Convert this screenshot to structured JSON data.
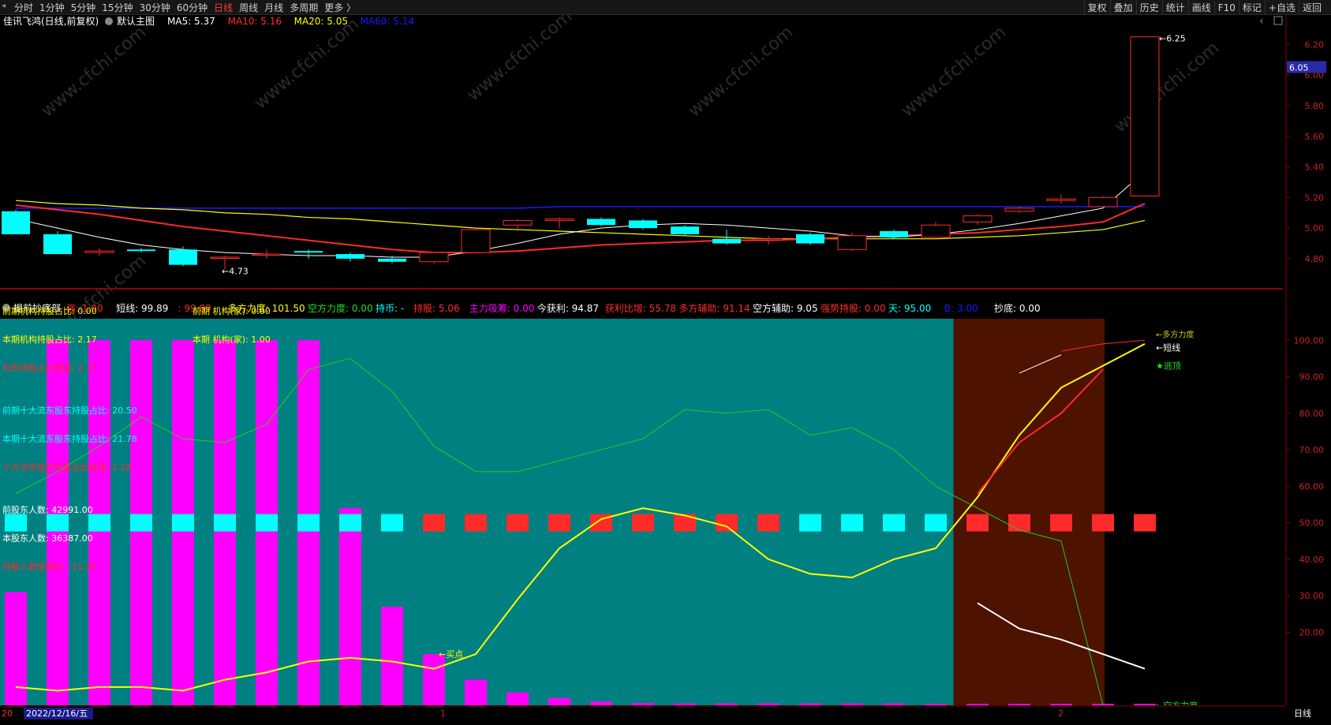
{
  "toolbar": {
    "periods": [
      "分时",
      "1分钟",
      "5分钟",
      "15分钟",
      "30分钟",
      "60分钟",
      "日线",
      "周线",
      "月线",
      "多周期",
      "更多 〉"
    ],
    "active_period": "日线",
    "tools": [
      "复权",
      "叠加",
      "历史",
      "统计",
      "画线",
      "F10",
      "标记",
      "+自选",
      "返回"
    ]
  },
  "colors": {
    "bg": "#000000",
    "red": "#ff2a2a",
    "cyan": "#00ffff",
    "yellow": "#ffff00",
    "magenta": "#ff00ff",
    "teal": "#008080",
    "brown": "#4d1200",
    "blue": "#1a1aff",
    "white": "#ffffff"
  },
  "main": {
    "stock": "佳讯飞鸿(日线,前复权)",
    "template": "默认主图",
    "ma": [
      {
        "label": "MA5: 5.37",
        "color": "#ffffff"
      },
      {
        "label": "MA10: 5.16",
        "color": "#ff2a2a"
      },
      {
        "label": "MA20: 5.05",
        "color": "#ffff00"
      },
      {
        "label": "MA60: 5.14",
        "color": "#1a1aff"
      }
    ],
    "high_label": "6.25",
    "low_label": "4.73",
    "current_price": "6.05"
  },
  "indicator": {
    "name": "提前抄底部",
    "stats": [
      {
        "t": "强: 1.00",
        "c": "#ff2a2a"
      },
      {
        "t": "短线: 99.89",
        "c": "#ffffff"
      },
      {
        "t": ": 99.89",
        "c": "#ff2a2a"
      },
      {
        "t": "多方力度: 101.50",
        "c": "#ffff00"
      },
      {
        "t": "空方力度: 0.00",
        "c": "#22dd22"
      },
      {
        "t": "持币: -",
        "c": "#00ffff"
      },
      {
        "t": "持股: 5.06",
        "c": "#ff2a2a"
      },
      {
        "t": "主力吸筹: 0.00",
        "c": "#ff00ff"
      },
      {
        "t": "今获利: 94.87",
        "c": "#ffffff"
      },
      {
        "t": "获利比增: 55.78",
        "c": "#ff2a2a"
      },
      {
        "t": "多方辅助: 91.14",
        "c": "#ff2a2a"
      },
      {
        "t": "空方辅助: 9.05",
        "c": "#ffffff"
      },
      {
        "t": "强势持股: 0.00",
        "c": "#ff2a2a"
      },
      {
        "t": "天: 95.00",
        "c": "#00ffff"
      },
      {
        "t": "B: 3.00",
        "c": "#1a1aff"
      },
      {
        "t": "抄底: 0.00",
        "c": "#ffffff"
      }
    ],
    "notes": [
      {
        "t": "前期机构持股占比: 0.00",
        "c": "#ffff00"
      },
      {
        "t": "本期机构持股占比: 2.17",
        "c": "#ffff00"
      },
      {
        "t": "机构持股占比增减: 2.17",
        "c": "#ff2a2a"
      },
      {
        "t": "前期十大流东股东持股占比: 20.50",
        "c": "#00ffff"
      },
      {
        "t": "本期十大流东股东持股占比: 21.78",
        "c": "#00ffff"
      },
      {
        "t": "十大流东股东持股占比增减: 1.28",
        "c": "#ff2a2a"
      },
      {
        "t": "前股东人数: 42991.00",
        "c": "#ffffff"
      },
      {
        "t": "本股东人数: 36387.00",
        "c": "#ffffff"
      },
      {
        "t": "持股人数增减比: -15.36",
        "c": "#ff2a2a"
      }
    ],
    "notes2": [
      {
        "t": "前期 机构(家): 0.00",
        "c": "#ffff00"
      },
      {
        "t": "本期 机构(家): 1.00",
        "c": "#ffff00"
      }
    ],
    "label_buy": "买点",
    "label_escape": "★逃顶",
    "label_short": "←短线",
    "label_bull": "←多方力度",
    "label_bear": "←空方力度"
  },
  "x_axis": {
    "date": "2022/12/16/五",
    "m1": "1",
    "m2": "2",
    "lead": "20"
  },
  "right_label": "日线",
  "chart_data": [
    {
      "type": "candlestick",
      "ylim": [
        4.65,
        6.3
      ],
      "yticks": [
        4.8,
        5.0,
        5.2,
        5.4,
        5.6,
        5.8,
        6.0,
        6.2
      ],
      "candles": [
        {
          "o": 5.11,
          "h": 5.12,
          "l": 4.96,
          "c": 4.96
        },
        {
          "o": 4.96,
          "h": 4.98,
          "l": 4.83,
          "c": 4.83
        },
        {
          "o": 4.84,
          "h": 4.87,
          "l": 4.82,
          "c": 4.85
        },
        {
          "o": 4.86,
          "h": 4.87,
          "l": 4.84,
          "c": 4.85
        },
        {
          "o": 4.86,
          "h": 4.88,
          "l": 4.75,
          "c": 4.76
        },
        {
          "o": 4.81,
          "h": 4.82,
          "l": 4.73,
          "c": 4.81
        },
        {
          "o": 4.83,
          "h": 4.86,
          "l": 4.8,
          "c": 4.83
        },
        {
          "o": 4.85,
          "h": 4.86,
          "l": 4.8,
          "c": 4.84
        },
        {
          "o": 4.83,
          "h": 4.84,
          "l": 4.78,
          "c": 4.8
        },
        {
          "o": 4.8,
          "h": 4.82,
          "l": 4.77,
          "c": 4.78
        },
        {
          "o": 4.78,
          "h": 4.84,
          "l": 4.77,
          "c": 4.84
        },
        {
          "o": 4.84,
          "h": 5.0,
          "l": 4.84,
          "c": 4.99
        },
        {
          "o": 5.02,
          "h": 5.06,
          "l": 4.98,
          "c": 5.05
        },
        {
          "o": 5.05,
          "h": 5.07,
          "l": 5.0,
          "c": 5.06
        },
        {
          "o": 5.06,
          "h": 5.07,
          "l": 5.01,
          "c": 5.02
        },
        {
          "o": 5.05,
          "h": 5.06,
          "l": 4.99,
          "c": 5.0
        },
        {
          "o": 5.01,
          "h": 5.02,
          "l": 4.95,
          "c": 4.96
        },
        {
          "o": 4.93,
          "h": 4.99,
          "l": 4.89,
          "c": 4.9
        },
        {
          "o": 4.93,
          "h": 4.95,
          "l": 4.89,
          "c": 4.93
        },
        {
          "o": 4.96,
          "h": 4.97,
          "l": 4.89,
          "c": 4.9
        },
        {
          "o": 4.86,
          "h": 4.97,
          "l": 4.85,
          "c": 4.95
        },
        {
          "o": 4.98,
          "h": 4.99,
          "l": 4.93,
          "c": 4.94
        },
        {
          "o": 4.94,
          "h": 5.04,
          "l": 4.93,
          "c": 5.02
        },
        {
          "o": 5.04,
          "h": 5.09,
          "l": 5.02,
          "c": 5.08
        },
        {
          "o": 5.11,
          "h": 5.14,
          "l": 5.1,
          "c": 5.13
        },
        {
          "o": 5.18,
          "h": 5.22,
          "l": 5.16,
          "c": 5.19
        },
        {
          "o": 5.14,
          "h": 5.21,
          "l": 5.13,
          "c": 5.2
        },
        {
          "o": 5.21,
          "h": 6.25,
          "l": 5.21,
          "c": 6.25
        }
      ],
      "ma5": [
        5.06,
        5.0,
        4.94,
        4.89,
        4.86,
        4.84,
        4.83,
        4.82,
        4.82,
        4.81,
        4.81,
        4.85,
        4.9,
        4.96,
        5.0,
        5.02,
        5.03,
        5.02,
        5.0,
        4.98,
        4.95,
        4.94,
        4.96,
        4.99,
        5.03,
        5.08,
        5.13,
        5.37
      ],
      "ma10": [
        5.15,
        5.12,
        5.09,
        5.05,
        5.01,
        4.98,
        4.95,
        4.92,
        4.89,
        4.86,
        4.84,
        4.84,
        4.85,
        4.87,
        4.89,
        4.9,
        4.91,
        4.92,
        4.92,
        4.93,
        4.94,
        4.95,
        4.96,
        4.97,
        4.99,
        5.01,
        5.04,
        5.16
      ],
      "ma20": [
        5.18,
        5.16,
        5.15,
        5.13,
        5.12,
        5.1,
        5.09,
        5.07,
        5.06,
        5.04,
        5.02,
        5.0,
        4.99,
        4.98,
        4.97,
        4.96,
        4.95,
        4.94,
        4.93,
        4.93,
        4.93,
        4.93,
        4.93,
        4.94,
        4.95,
        4.97,
        4.99,
        5.05
      ],
      "ma60": [
        5.13,
        5.13,
        5.13,
        5.13,
        5.13,
        5.13,
        5.13,
        5.13,
        5.13,
        5.13,
        5.13,
        5.13,
        5.13,
        5.14,
        5.14,
        5.14,
        5.14,
        5.14,
        5.14,
        5.14,
        5.14,
        5.14,
        5.14,
        5.14,
        5.14,
        5.14,
        5.14,
        5.14
      ]
    },
    {
      "type": "bar",
      "ylim": [
        0,
        102
      ],
      "yticks": [
        20,
        30,
        40,
        50,
        60,
        70,
        80,
        90,
        100
      ],
      "magenta_bars": [
        31,
        100,
        100,
        100,
        100,
        100,
        100,
        100,
        54,
        27,
        14,
        7,
        3.5,
        2,
        1,
        0.6,
        0.5,
        0.5,
        0.5,
        0.5,
        0.5,
        0.5,
        0.4,
        0.4,
        0.4,
        0.4,
        0.4,
        0.4
      ],
      "signal_squares": [
        "c",
        "c",
        "c",
        "c",
        "c",
        "c",
        "c",
        "c",
        "c",
        "c",
        "r",
        "r",
        "r",
        "r",
        "r",
        "r",
        "r",
        "r",
        "r",
        "c",
        "c",
        "c",
        "c",
        "r",
        "r",
        "r",
        "r",
        "r"
      ],
      "yellow_line": [
        5,
        4,
        5,
        5,
        4,
        7,
        9,
        12,
        13,
        12,
        10,
        14,
        29,
        43,
        51,
        54,
        52,
        49,
        40,
        36,
        35,
        40,
        43,
        57,
        74,
        87,
        93,
        99
      ],
      "green_line": [
        58,
        64,
        71,
        79,
        73,
        72,
        77,
        92,
        95,
        86,
        71,
        64,
        64,
        67,
        70,
        73,
        81,
        80,
        81,
        74,
        76,
        70,
        60,
        54,
        48,
        45,
        0
      ],
      "red_line": [
        58,
        72,
        80,
        92
      ],
      "red_line_start": 23,
      "white_line": [
        28,
        21,
        18,
        14,
        10
      ],
      "white_line_start": 23,
      "white_top": [
        91,
        96
      ],
      "red_top": [
        97,
        99,
        100
      ],
      "zone_split": 22
    }
  ]
}
